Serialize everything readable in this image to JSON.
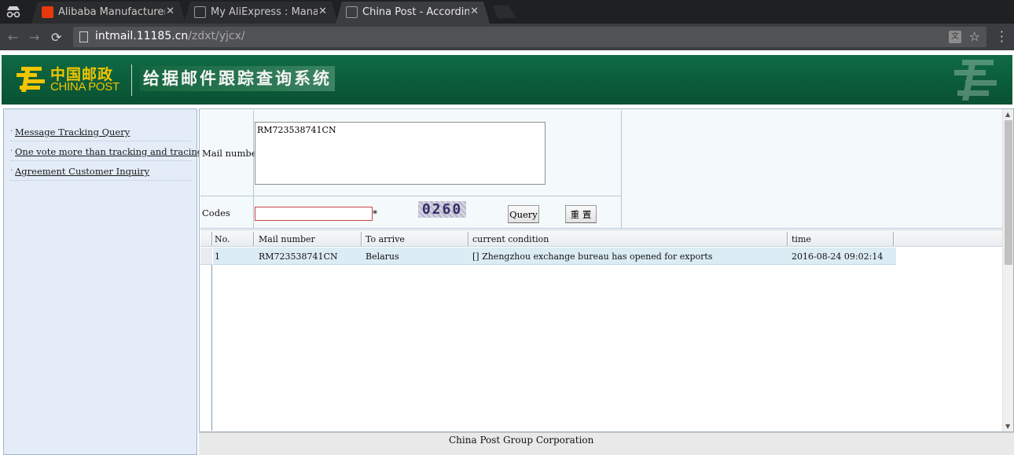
{
  "browser": {
    "tabs": [
      {
        "title": "Alibaba Manufacturer D",
        "favicon": "alibaba-icon",
        "active": false
      },
      {
        "title": "My AliExpress : Manage",
        "favicon": "document-icon",
        "active": false
      },
      {
        "title": "China Post - According",
        "favicon": "document-icon",
        "active": true
      }
    ],
    "close_glyph": "✕",
    "url_host": "intmail.11185.cn",
    "url_path": "/zdxt/yjcx/"
  },
  "header": {
    "logo_cn": "中国邮政",
    "logo_en": "CHINA POST",
    "system_title": "给据邮件跟踪查询系统",
    "brand_green": "#0b5c3a",
    "brand_yellow": "#f2c500"
  },
  "sidebar": {
    "items": [
      {
        "label": "Message Tracking Query"
      },
      {
        "label": "One vote more than tracking and tracing"
      },
      {
        "label": "Agreement Customer Inquiry"
      }
    ]
  },
  "form": {
    "mail_number_label": "Mail number",
    "mail_number_value": "RM723538741CN",
    "codes_label": "Codes",
    "codes_value": "",
    "required_mark": "*",
    "captcha_text": "0260",
    "query_button": "Query",
    "reset_button": "重 置"
  },
  "results": {
    "columns": [
      "No.",
      "Mail number",
      "To arrive",
      "current condition",
      "time"
    ],
    "rows": [
      {
        "no": "1",
        "mail_number": "RM723538741CN",
        "to_arrive": "Belarus",
        "condition": "[]  Zhengzhou exchange bureau has opened for exports",
        "time": "2016-08-24 09:02:14"
      }
    ]
  },
  "footer": {
    "text": "China Post Group Corporation"
  }
}
